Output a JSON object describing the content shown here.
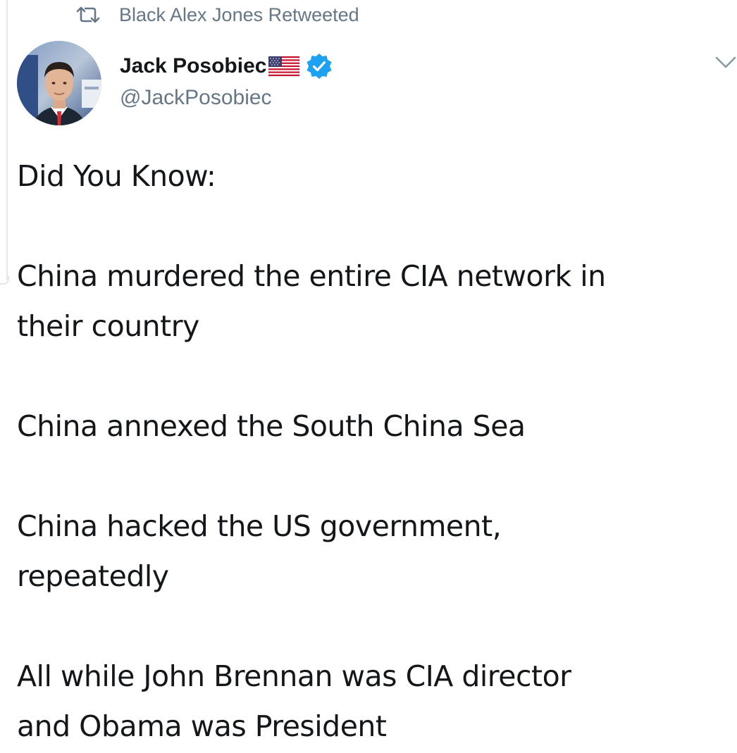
{
  "retweet": {
    "icon": "retweet-icon",
    "label": "Black Alex Jones Retweeted"
  },
  "author": {
    "name": "Jack Posobiec",
    "handle": "@JackPosobiec",
    "flag_icon": "us-flag-icon",
    "verified_icon": "verified-badge-icon",
    "avatar": "avatar"
  },
  "menu": {
    "icon": "chevron-down-icon"
  },
  "tweet": {
    "line1": "Did You Know:",
    "line2": "China murdered the entire CIA network in\ntheir country",
    "line3": "China annexed the South China Sea",
    "line4": "China hacked the US government,\nrepeatedly",
    "line5": "All while John Brennan was CIA director\nand Obama was President"
  },
  "colors": {
    "text": "#14171a",
    "muted": "#657786",
    "verified": "#1da1f2",
    "thread_line": "#e1e8ed"
  }
}
